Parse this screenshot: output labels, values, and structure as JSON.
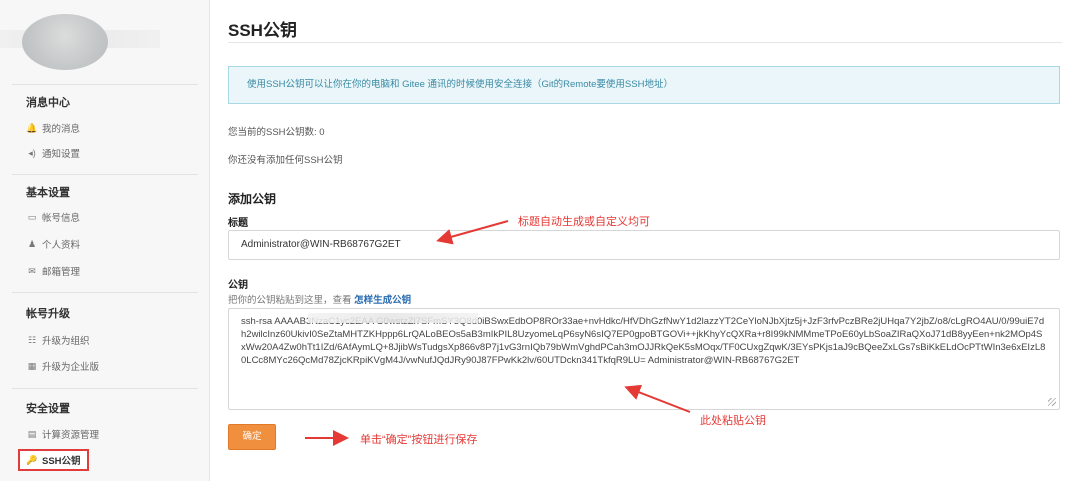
{
  "sidebar": {
    "sections": [
      {
        "title": "消息中心",
        "items": [
          {
            "icon": "bell-icon",
            "glyph": "🔔",
            "label": "我的消息"
          },
          {
            "icon": "speaker-icon",
            "glyph": "◂)",
            "label": "通知设置"
          }
        ]
      },
      {
        "title": "基本设置",
        "items": [
          {
            "icon": "card-icon",
            "glyph": "▭",
            "label": "帐号信息"
          },
          {
            "icon": "user-icon",
            "glyph": "♟",
            "label": "个人资料"
          },
          {
            "icon": "mail-icon",
            "glyph": "✉",
            "label": "邮箱管理"
          }
        ]
      },
      {
        "title": "帐号升级",
        "items": [
          {
            "icon": "group-icon",
            "glyph": "☷",
            "label": "升级为组织"
          },
          {
            "icon": "building-icon",
            "glyph": "▦",
            "label": "升级为企业版"
          }
        ]
      },
      {
        "title": "安全设置",
        "items": [
          {
            "icon": "server-icon",
            "glyph": "▤",
            "label": "计算资源管理"
          },
          {
            "icon": "key-icon",
            "glyph": "🔑",
            "label": "SSH公钥"
          }
        ]
      }
    ]
  },
  "main": {
    "title": "SSH公钥",
    "info": "使用SSH公钥可以让你在你的电脑和 Gitee 通讯的时候使用安全连接（Git的Remote要使用SSH地址）",
    "count_text": "您当前的SSH公钥数: 0",
    "empty_text": "你还没有添加任何SSH公钥",
    "add_title": "添加公钥",
    "title_label": "标题",
    "title_value": "Administrator@WIN-RB68767G2ET",
    "key_label": "公钥",
    "key_hint": "把你的公钥粘贴到这里，查看 ",
    "key_hint_link": "怎样生成公钥",
    "key_value": "ssh-rsa AAAAB3NzaC1yc2EAA                              G0wstzZl7SFmSY3Q8d0iBSwxEdbOP8ROr33ae+nvHdkc/HfVDhGzfNwY1d2lazzYT2CeYloNJbXjtz5j+JzF3rfvPczBRe2jUHqa7Y2jbZ/o8/cLgRO4AU/0/99uiE7dh2wilcInz60UkivI0SeZtaMHTZKHppp6LrQALoBEOs5aB3mIkPIL8UzyomeLqP6syN6sIQ7EP0gpoBTGOVi++jkKhyYcQXRa+r8I99kNMMmeTPoE60yLbSoaZIRaQXoJ71dB8yyEen+nk2MOp4SxWw20A4Zw0hTt1IZd/6AfAymLQ+8JjibWsTudgsXp866v8P7j1vG3rnIQb79bWmVghdPCah3mOJJRkQeK5sMOqx/TF0CUxgZqwK/3EYsPKjs1aJ9cBQeeZxLGs7sBiKkELdOcPTtWIn3e6xEIzL80LCc8MYc26QcMd78ZjcKRpiKVgM4J/vwNufJQdJRy90J87FPwKk2lv/60UTDckn341TkfqR9LU= Administrator@WIN-RB68767G2ET",
    "confirm_label": "确定"
  },
  "annotations": {
    "title_note": "标题自动生成或自定义均可",
    "key_note": "此处粘贴公钥",
    "button_note": "单击“确定”按钮进行保存",
    "color": "#e53935"
  },
  "colors": {
    "accent_button": "#f08f3e",
    "info_bg": "#eaf6f9",
    "info_text": "#3a8aa5",
    "link": "#2a6cb0"
  }
}
